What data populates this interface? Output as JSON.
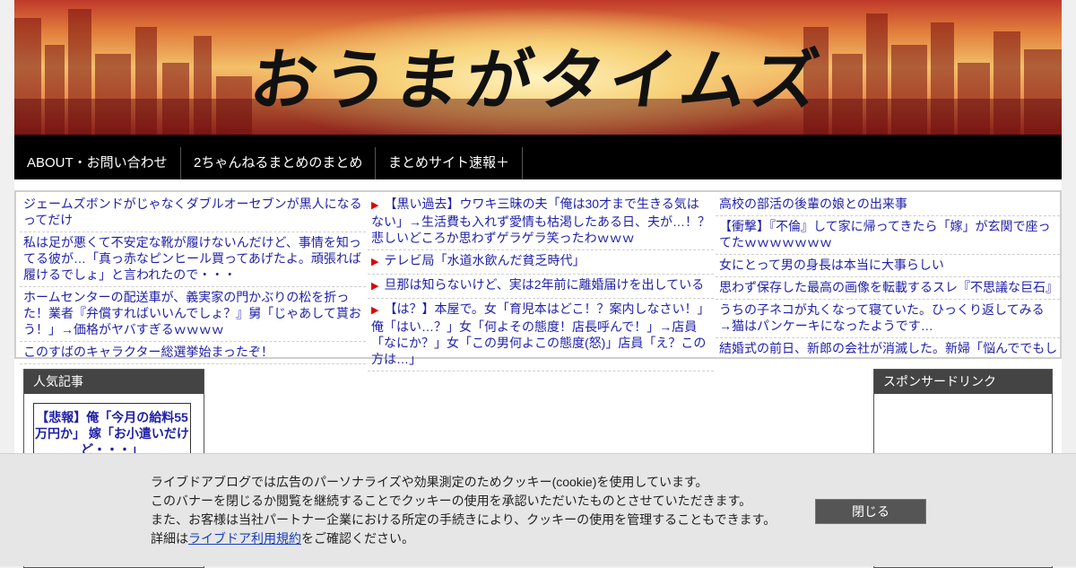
{
  "site": {
    "title": "おうまがタイムズ"
  },
  "nav": {
    "items": [
      {
        "label": "ABOUT・お問い合わせ"
      },
      {
        "label": "2ちゃんねるまとめのまとめ"
      },
      {
        "label": "まとめサイト速報＋"
      }
    ]
  },
  "ticker": {
    "col1": [
      "ジェームズボンドがじゃなくダブルオーセブンが黒人になるってだけ",
      "私は足が悪くて不安定な靴が履けないんだけど、事情を知ってる彼が…「真っ赤なピンヒール買ってあげたよ。頑張れば履けるでしょ」と言われたので・・・",
      "ホームセンターの配送車が、義実家の門かぶりの松を折った！業者『弁償すればいいんでしょ？』舅「じゃあして貰おう！」→価格がヤバすぎるｗｗｗｗ",
      "このすばのキャラクター総選挙始まったぞ！"
    ],
    "col2": [
      "【黒い過去】ウワキ三昧の夫「俺は30才まで生きる気はない」→生活費も入れず愛情も枯渇したある日、夫が…！？悲しいどころか思わずゲラゲラ笑ったわｗｗｗ",
      "テレビ局「水道水飲んだ貧乏時代」",
      "旦那は知らないけど、実は2年前に離婚届けを出している",
      "【は？】本屋で。女「育児本はどこ！？案内しなさい！」俺「はい…？」女「何よその態度！店長呼んで！」→店員「なにか？」女「この男何よこの態度(怒)」店員「え？この方は…」"
    ],
    "col3": [
      "高校の部活の後輩の娘との出来事",
      "【衝撃】『不倫』して家に帰ってきたら「嫁」が玄関で座ってたｗｗｗｗｗｗｗ",
      "女にとって男の身長は本当に大事らしい",
      "思わず保存した最高の画像を転載するスレ『不思議な巨石』",
      "うちの子ネコが丸くなって寝ていた。ひっくり返してみる→猫はパンケーキになったようです…",
      "結婚式の前日、新郎の会社が消滅した。新婦「悩んででもし"
    ]
  },
  "popular": {
    "heading": "人気記事",
    "top_title": "【悲報】俺「今月の給料55万円か」 嫁「お小遣いだけど・・・」"
  },
  "sponsor": {
    "heading": "スポンサードリンク"
  },
  "cookie_banner": {
    "line1": "ライブドアブログでは広告のパーソナライズや効果測定のためクッキー(cookie)を使用しています。",
    "line2": "このバナーを閉じるか閲覧を継続することでクッキーの使用を承認いただいたものとさせていただきます。",
    "line3": "また、お客様は当社パートナー企業における所定の手続きにより、クッキーの使用を管理することもできます。",
    "line4_prefix": "詳細は",
    "line4_link": "ライブドア利用規約",
    "line4_suffix": "をご確認ください。",
    "close_label": "閉じる"
  },
  "colors": {
    "link": "#1f1fa8",
    "nav_bg": "#000000",
    "bullet": "#e00000",
    "panel_head": "#444444"
  }
}
